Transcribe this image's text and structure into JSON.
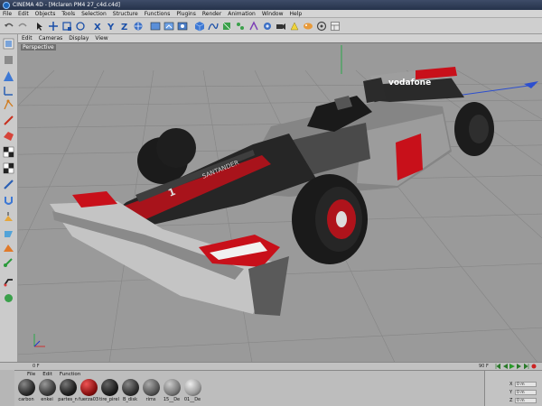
{
  "window": {
    "title": "CINEMA 4D - [Mclaren PM4 27_c4d.c4d]"
  },
  "menubar": [
    "File",
    "Edit",
    "Objects",
    "Tools",
    "Selection",
    "Structure",
    "Functions",
    "Plugins",
    "Render",
    "Animation",
    "Window",
    "Help"
  ],
  "viewport_menu": [
    "Edit",
    "Cameras",
    "Display",
    "View"
  ],
  "viewport": {
    "label": "Perspective"
  },
  "timeline": {
    "current_frame": "0 F",
    "end_frame": "90 F"
  },
  "material_menu": [
    "File",
    "Edit",
    "Function"
  ],
  "materials": [
    {
      "name": "carbon",
      "color": "#2a2a2a"
    },
    {
      "name": "enkei",
      "color": "#3a3a3a"
    },
    {
      "name": "partes_n",
      "color": "#1e1e1e"
    },
    {
      "name": "fuerza03",
      "color": "#8a1010"
    },
    {
      "name": "tire_pirell",
      "color": "#1c1c1c"
    },
    {
      "name": "B_disk",
      "color": "#303030"
    },
    {
      "name": "rims",
      "color": "#555555"
    },
    {
      "name": "15__De",
      "color": "#777777"
    },
    {
      "name": "01__De",
      "color": "#9a9a9a"
    }
  ],
  "coords": [
    {
      "axis": "X",
      "value": "0 m"
    },
    {
      "axis": "Y",
      "value": "0 m"
    },
    {
      "axis": "Z",
      "value": "0 m"
    }
  ],
  "car": {
    "livery_text": "vodafone",
    "sidepod_text": "SANTANDER",
    "nose_number": "1"
  },
  "colors": {
    "accent_red": "#c8101a",
    "body_dark": "#262626",
    "body_silver": "#8e8e8e",
    "viewport_bg": "#9a9a9a"
  }
}
